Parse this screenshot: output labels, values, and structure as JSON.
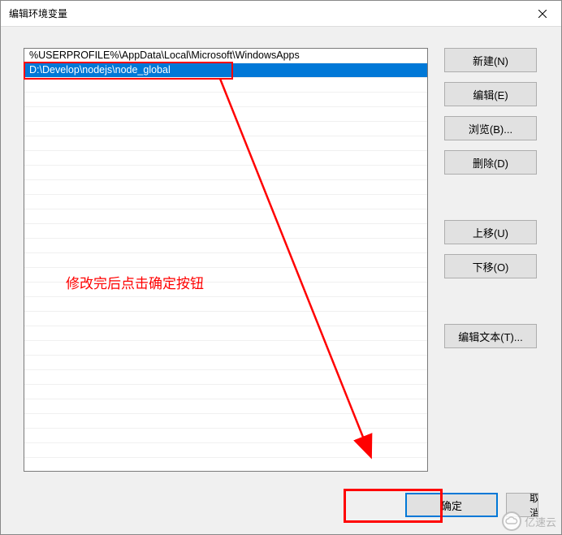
{
  "title": "编辑环境变量",
  "list": {
    "items": [
      "%USERPROFILE%\\AppData\\Local\\Microsoft\\WindowsApps",
      "D:\\Develop\\nodejs\\node_global"
    ],
    "selected_index": 1
  },
  "buttons": {
    "new": "新建(N)",
    "edit": "编辑(E)",
    "browse": "浏览(B)...",
    "delete": "删除(D)",
    "move_up": "上移(U)",
    "move_down": "下移(O)",
    "edit_text": "编辑文本(T)...",
    "ok": "确定",
    "cancel": "取消"
  },
  "annotation": {
    "text": "修改完后点击确定按钮"
  },
  "watermark": {
    "text": "亿速云"
  }
}
